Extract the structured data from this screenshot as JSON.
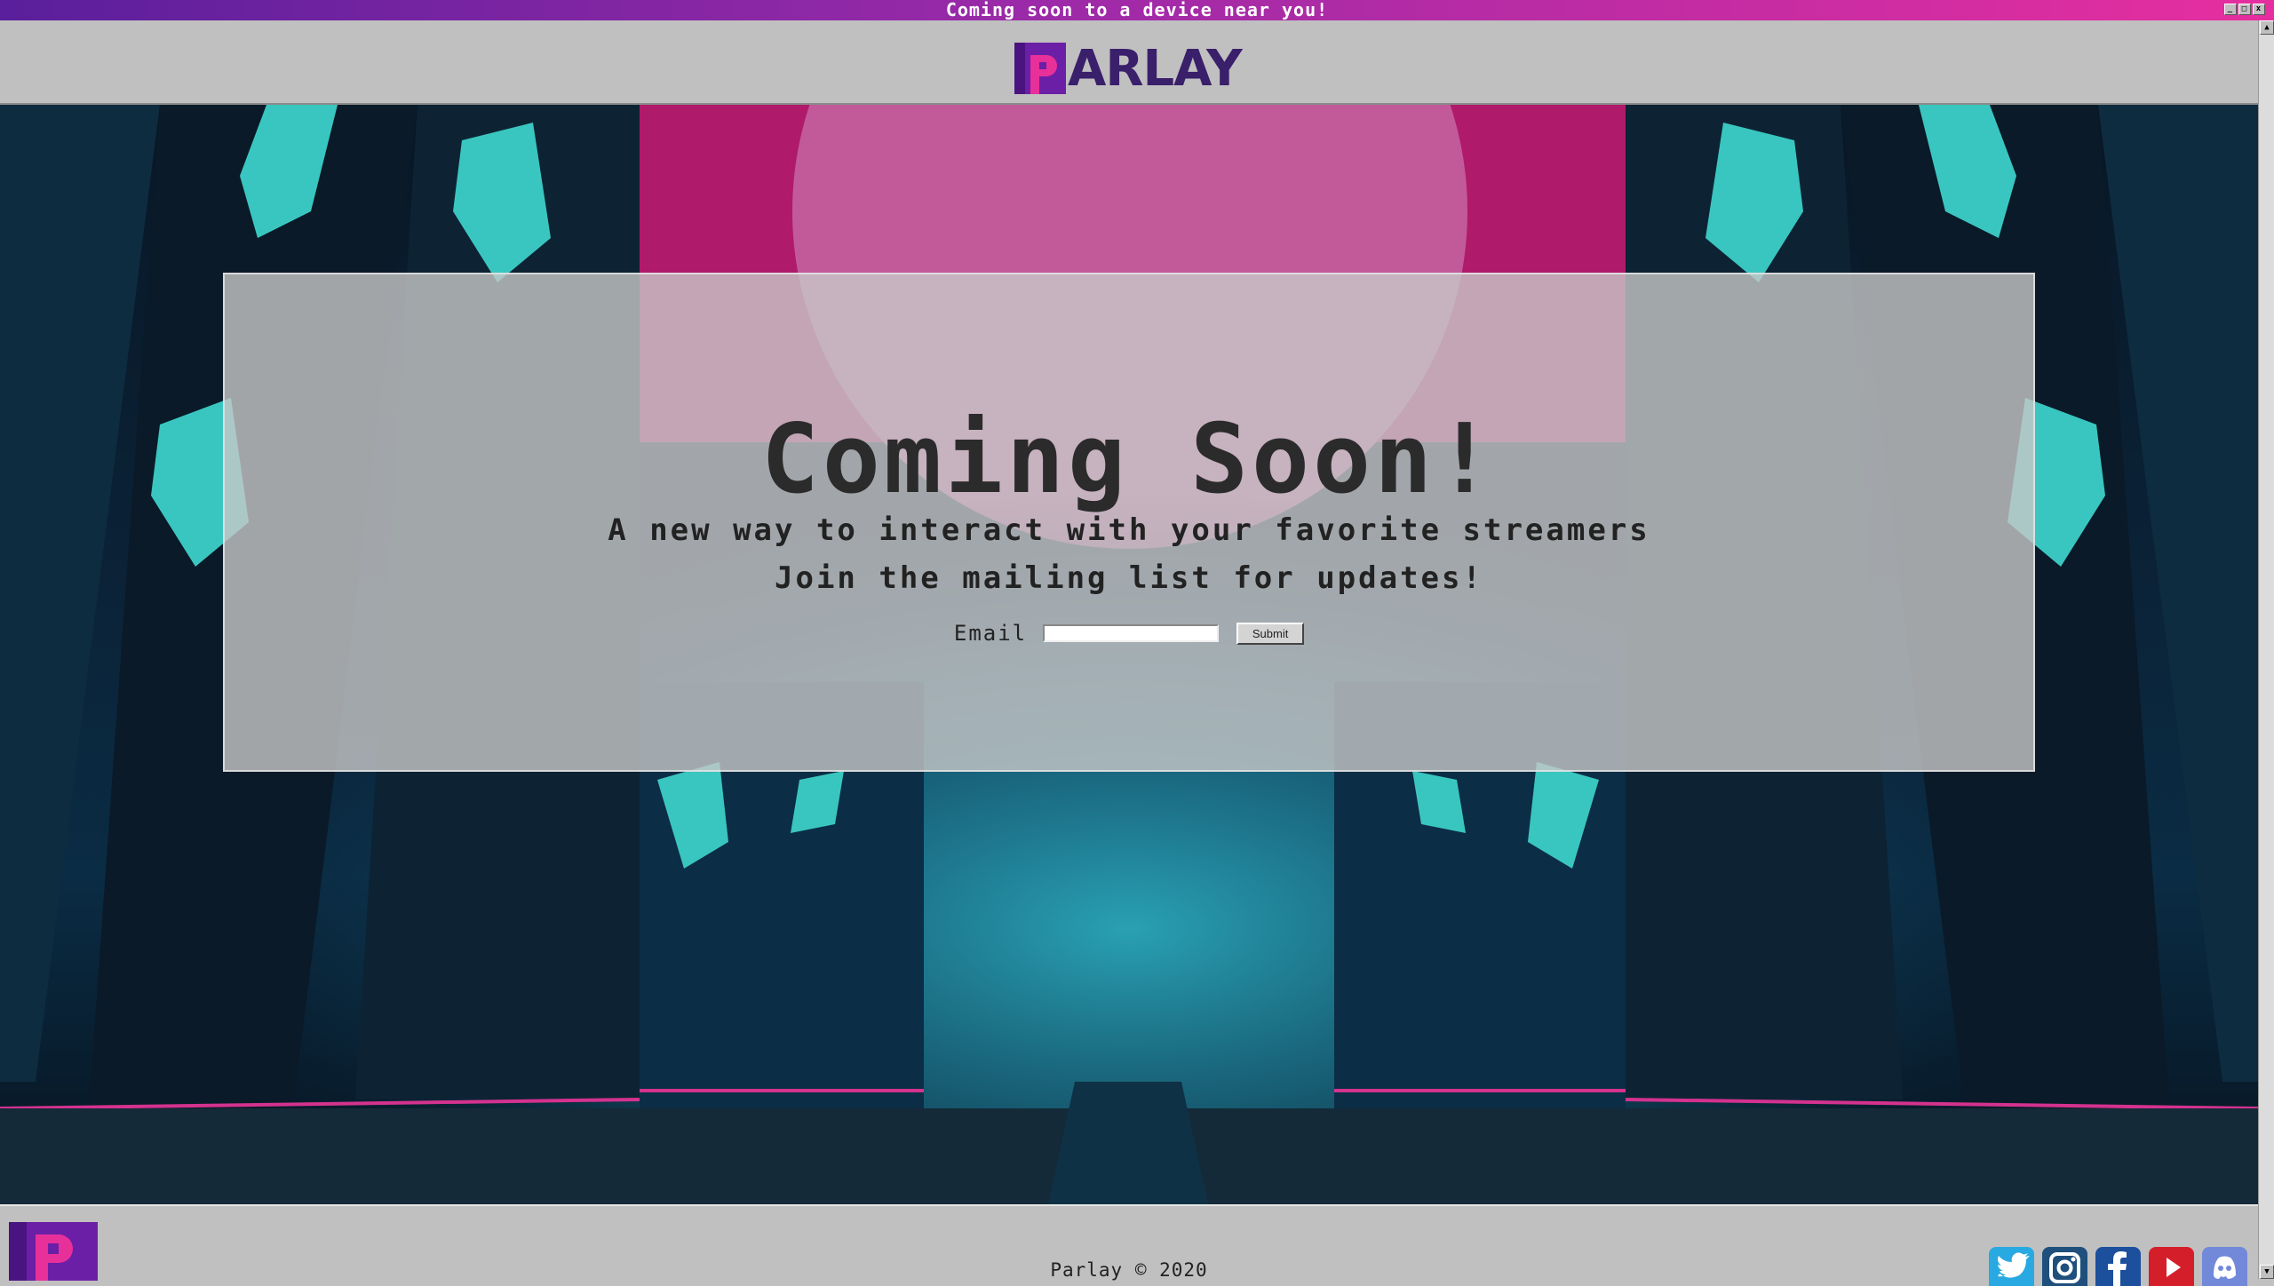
{
  "window": {
    "title": "Coming soon to a device near you!",
    "buttons": {
      "minimize": "_",
      "maximize": "□",
      "close": "x"
    }
  },
  "header": {
    "logo_text": "ARLAY"
  },
  "main": {
    "headline": "Coming Soon!",
    "tagline": "A new way to interact with your favorite streamers",
    "mailing_prompt": "Join the mailing list for updates!",
    "form": {
      "email_label": "Email",
      "email_value": "",
      "email_placeholder": "",
      "submit_label": "Submit"
    }
  },
  "footer": {
    "copyright": "Parlay © 2020",
    "social": [
      {
        "name": "twitter-icon"
      },
      {
        "name": "instagram-icon"
      },
      {
        "name": "facebook-icon"
      },
      {
        "name": "youtube-icon"
      },
      {
        "name": "discord-icon"
      }
    ]
  },
  "colors": {
    "titlebar_start": "#5a1f9c",
    "titlebar_end": "#e62e9f",
    "brand_purple": "#6b1fa6",
    "brand_pink": "#e8309a",
    "chrome_gray": "#c0c0c0"
  },
  "scrollbar": {
    "up": "▲",
    "down": "▼"
  }
}
